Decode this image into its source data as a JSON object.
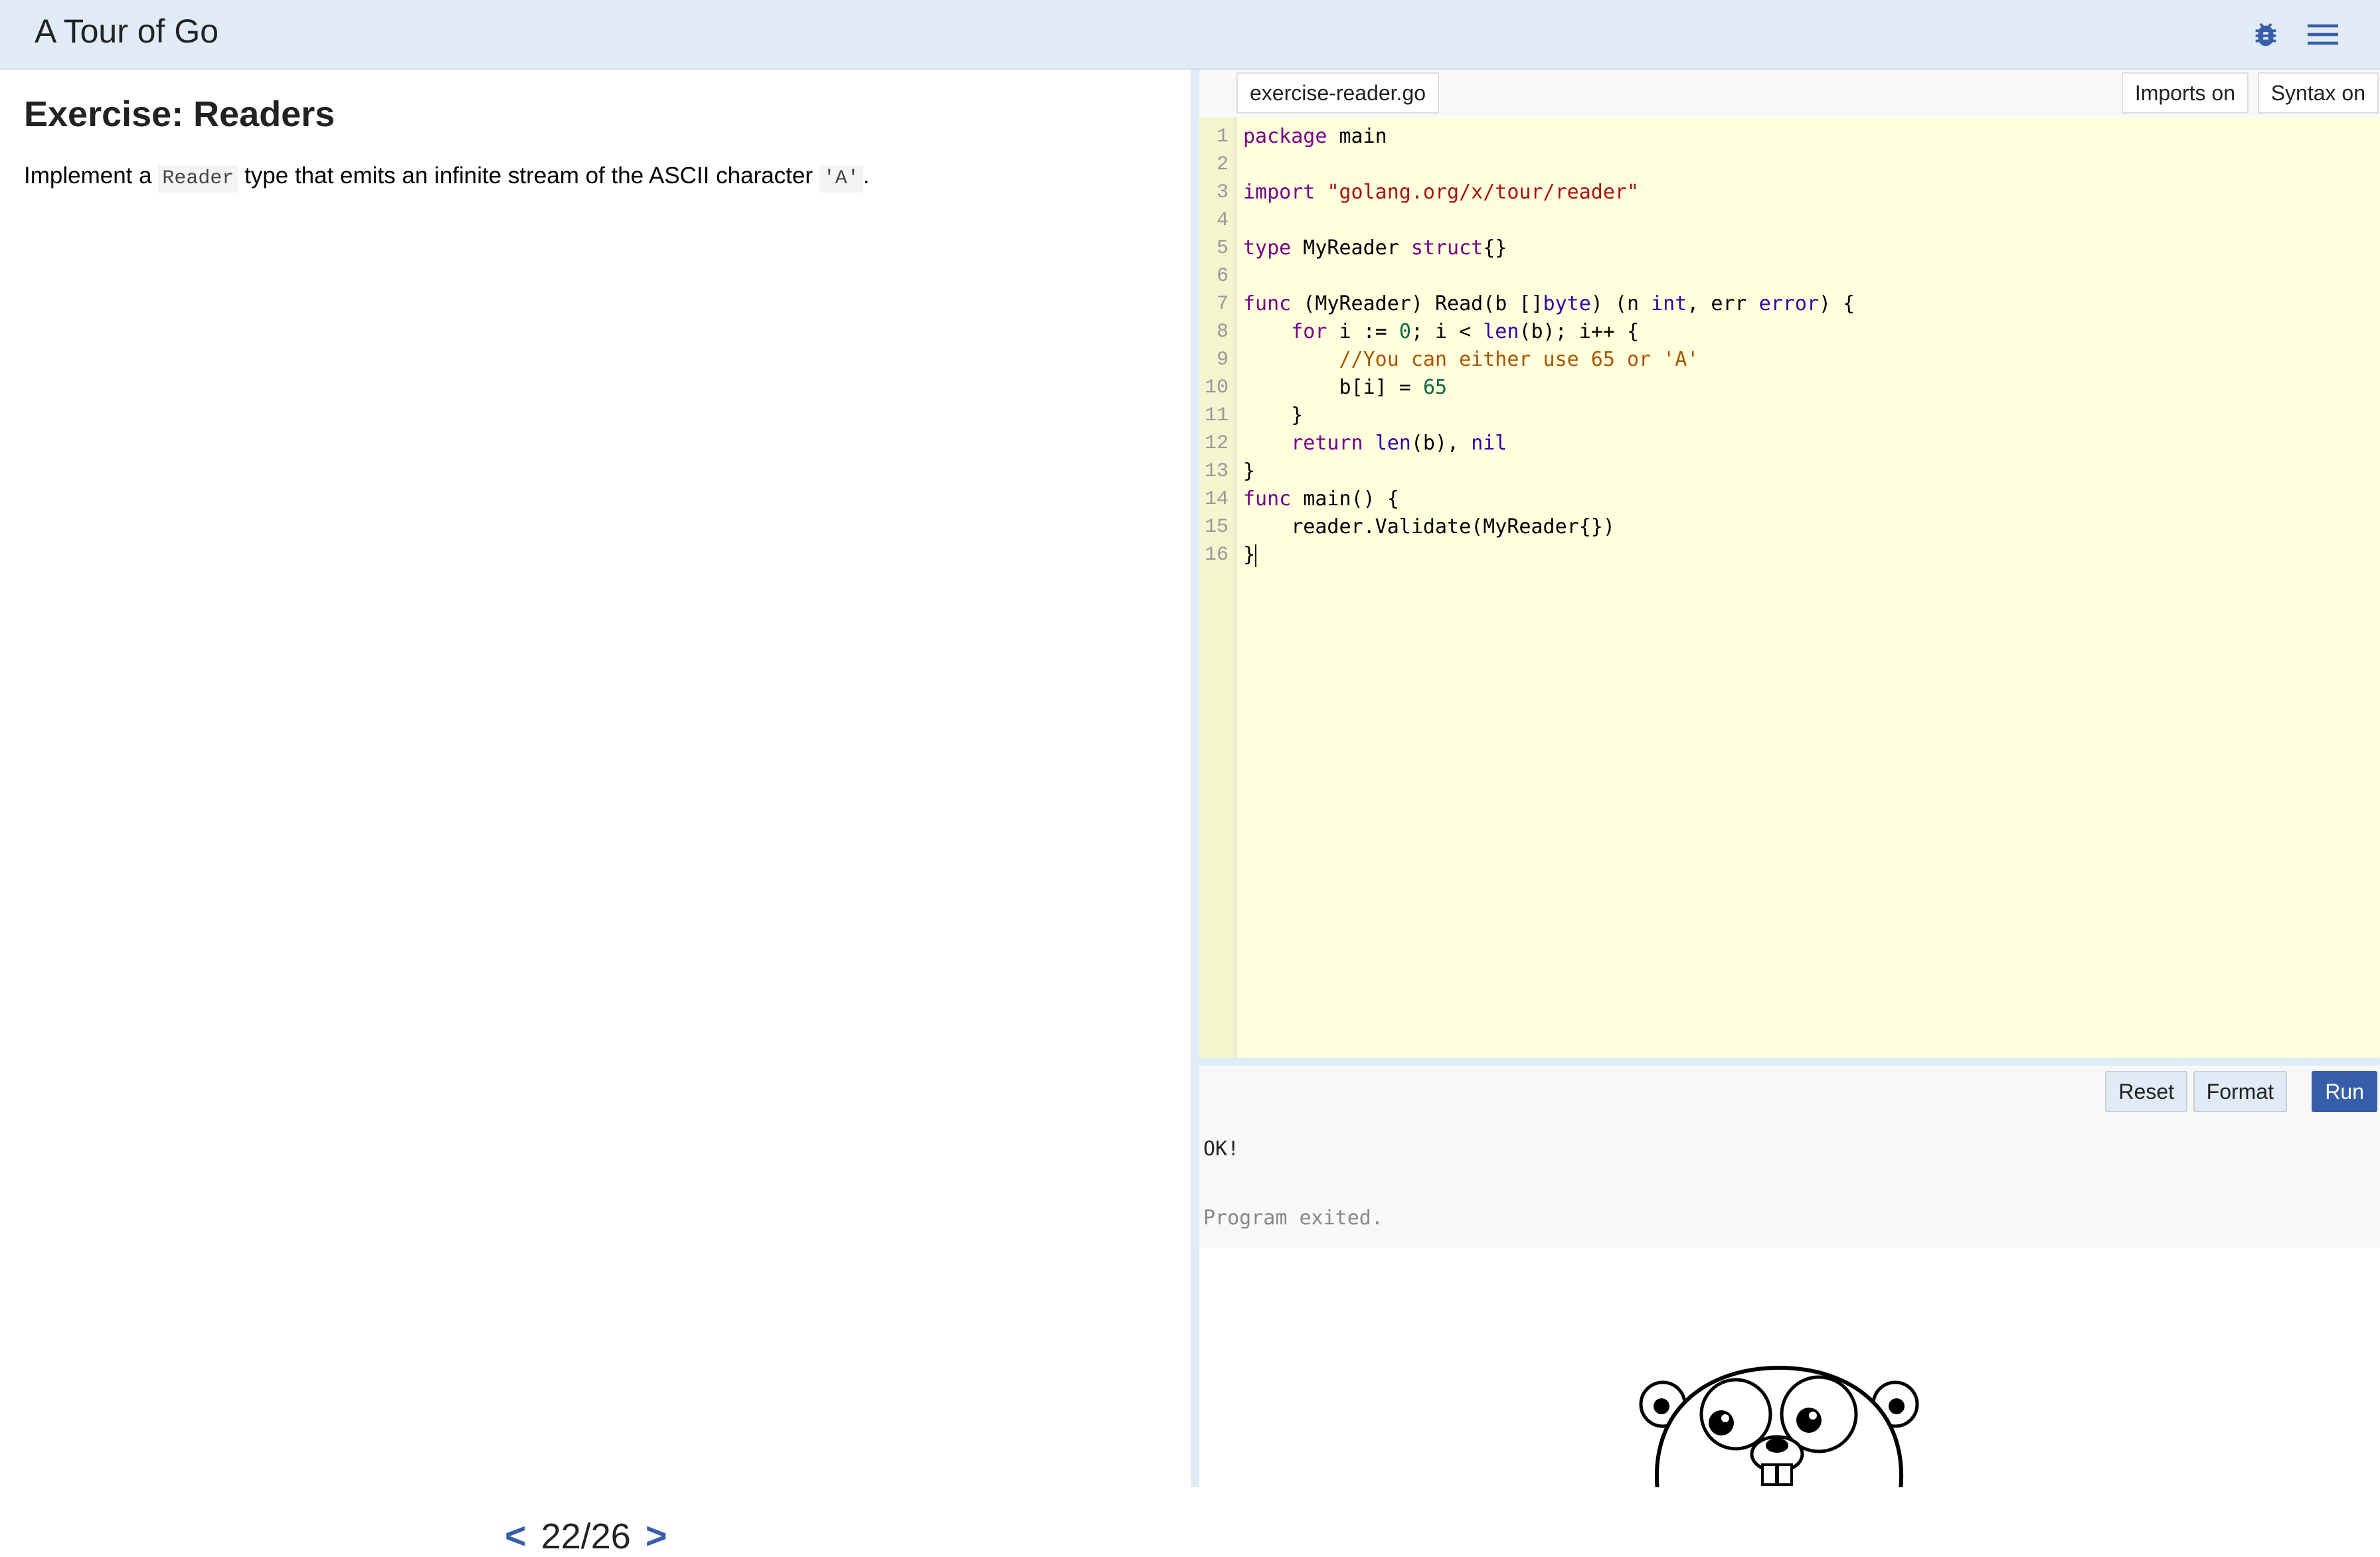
{
  "header": {
    "title": "A Tour of Go",
    "icons": [
      "bug-icon",
      "menu-icon"
    ]
  },
  "lesson": {
    "heading": "Exercise: Readers",
    "desc_before": "Implement a ",
    "desc_code1": "Reader",
    "desc_middle": " type that emits an infinite stream of the ASCII character ",
    "desc_code2": "'A'",
    "desc_after": "."
  },
  "pager": {
    "prev": "<",
    "page": "22/26",
    "next": ">"
  },
  "editor": {
    "filename": "exercise-reader.go",
    "imports_toggle": "Imports on",
    "syntax_toggle": "Syntax on",
    "line_numbers": "1\n2\n3\n4\n5\n6\n7\n8\n9\n10\n11\n12\n13\n14\n15\n16",
    "code": "package main\n\nimport \"golang.org/x/tour/reader\"\n\ntype MyReader struct{}\n\nfunc (MyReader) Read(b []byte) (n int, err error) {\n    for i := 0; i < len(b); i++ {\n        //You can either use 65 or 'A'\n        b[i] = 65\n    }\n    return len(b), nil\n}\nfunc main() {\n    reader.Validate(MyReader{})\n}"
  },
  "actions": {
    "reset": "Reset",
    "format": "Format",
    "run": "Run"
  },
  "output": {
    "result": "OK!",
    "status": "Program exited."
  },
  "colors": {
    "accent": "#375eab",
    "header_bg": "#e0ebf5",
    "editor_bg": "#ffffdd"
  }
}
